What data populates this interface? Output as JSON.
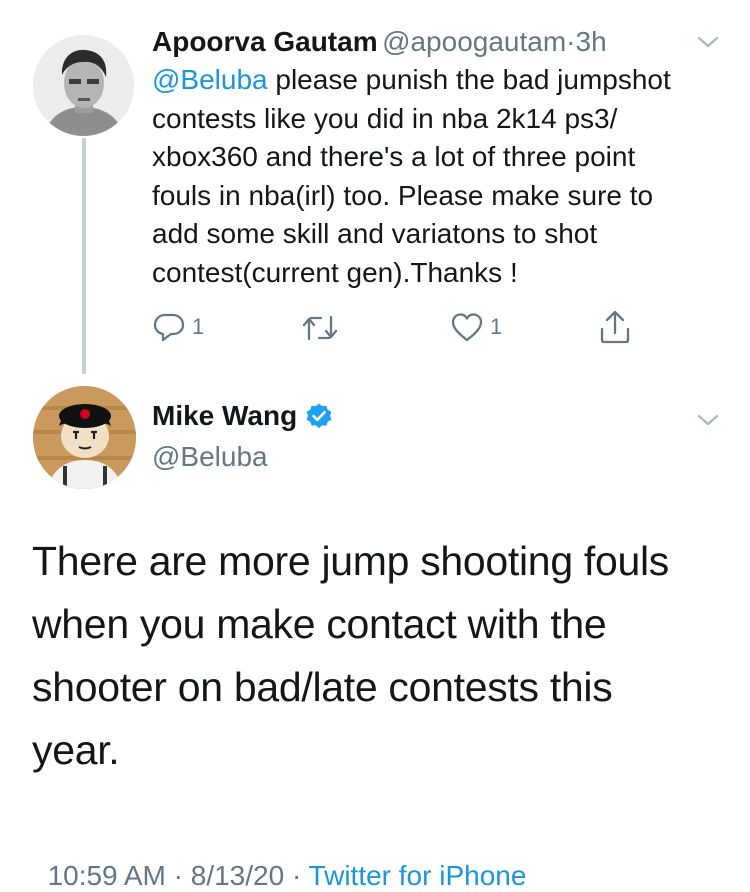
{
  "reply_tweet": {
    "author_name": "Apoorva Gautam",
    "author_handle": "@apoogautam",
    "separator": "·",
    "time": "3h",
    "mention": "@Beluba",
    "text_lines": [
      " please punish the bad jumpshot",
      "contests like you did in nba 2k14 ps3/",
      "xbox360 and there's a lot of three point",
      "fouls in nba(irl) too. Please make sure to",
      "add some skill and variatons to shot",
      "contest(current gen).Thanks !"
    ],
    "reply_count": "1",
    "like_count": "1",
    "icons": [
      "reply-icon",
      "retweet-icon",
      "like-icon",
      "share-icon",
      "chevron-down-icon"
    ]
  },
  "main_tweet": {
    "author_name": "Mike Wang",
    "author_handle": "@Beluba",
    "verified": true,
    "text_lines": [
      "There are more jump shooting fouls",
      "when you make contact with the",
      "shooter on bad/late contests this",
      "year."
    ],
    "timestamp": "10:59 AM · 8/13/20 · ",
    "source": "Twitter for iPhone"
  },
  "colors": {
    "accent": "#1b95e0",
    "muted": "#657786",
    "verified": "#1da1f2"
  }
}
